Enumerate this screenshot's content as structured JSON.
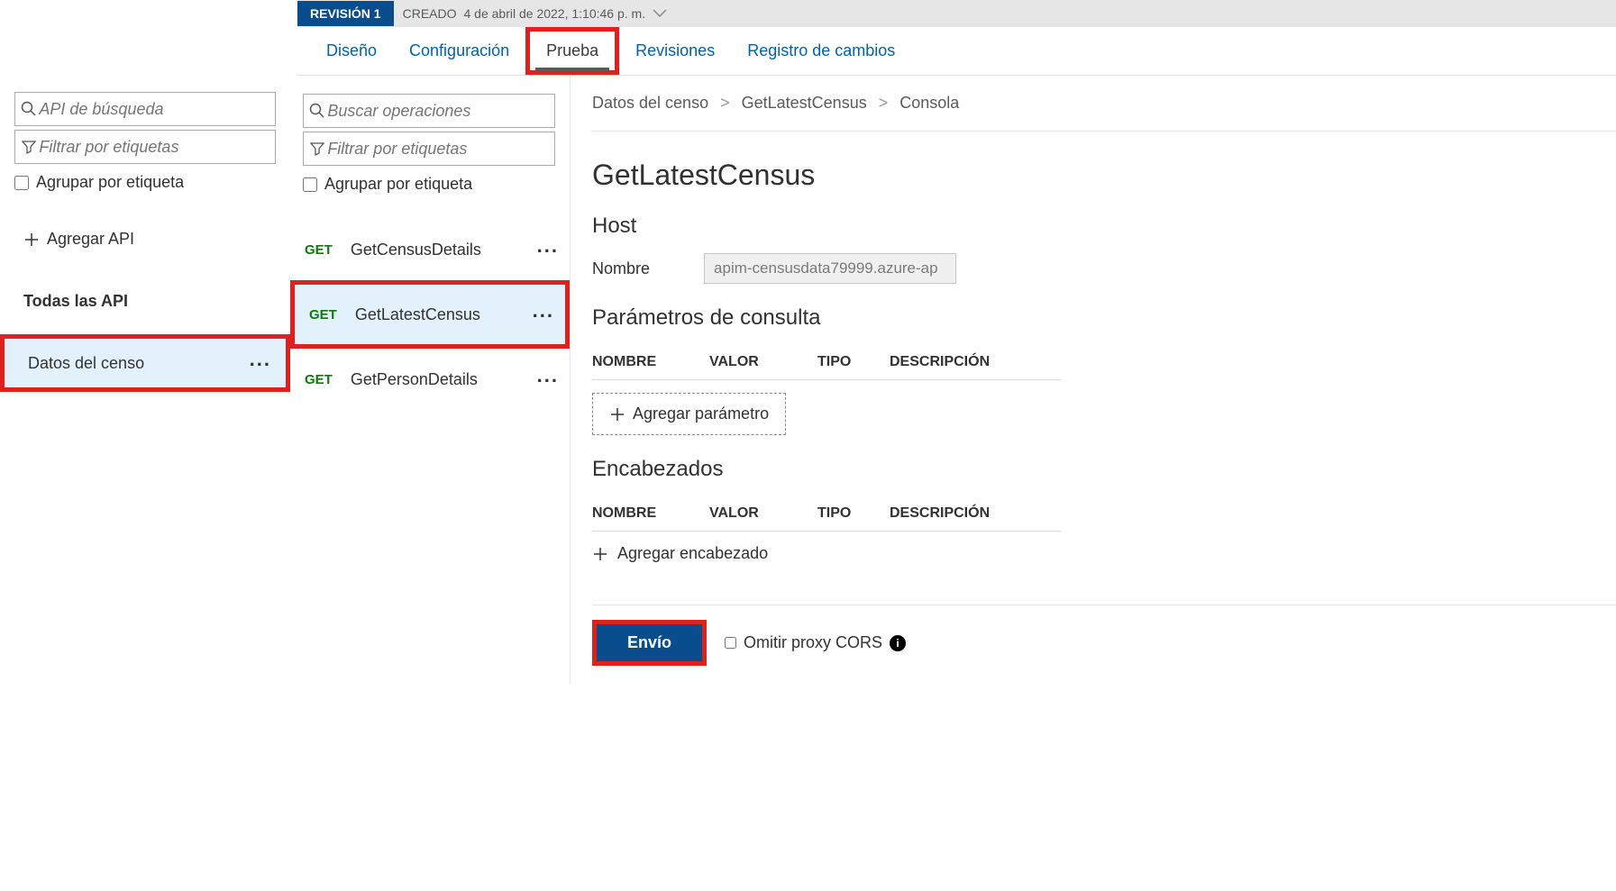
{
  "revision": {
    "label": "REVISIÓN 1",
    "created_prefix": "CREADO",
    "created_date": "4 de abril de 2022, 1:10:46 p. m."
  },
  "tabs": {
    "design": "Diseño",
    "settings": "Configuración",
    "test": "Prueba",
    "revisions": "Revisiones",
    "changelog": "Registro de cambios"
  },
  "sidebar_apis": {
    "search_placeholder": "API de búsqueda",
    "filter_placeholder": "Filtrar por etiquetas",
    "group_by_tag": "Agrupar por etiqueta",
    "add_api": "Agregar API",
    "all_apis": "Todas las API",
    "selected_api": "Datos del censo"
  },
  "sidebar_ops": {
    "search_placeholder": "Buscar operaciones",
    "filter_placeholder": "Filtrar por etiquetas",
    "group_by_tag": "Agrupar por etiqueta",
    "items": [
      {
        "method": "GET",
        "name": "GetCensusDetails"
      },
      {
        "method": "GET",
        "name": "GetLatestCensus"
      },
      {
        "method": "GET",
        "name": "GetPersonDetails"
      }
    ]
  },
  "breadcrumb": {
    "api": "Datos del censo",
    "op": "GetLatestCensus",
    "console": "Consola"
  },
  "main": {
    "title": "GetLatestCensus",
    "host_heading": "Host",
    "host_name_label": "Nombre",
    "host_value": "apim-censusdata79999.azure-ap",
    "query_params_heading": "Parámetros de consulta",
    "col_name": "NOMBRE",
    "col_value": "VALOR",
    "col_type": "TIPO",
    "col_desc": "DESCRIPCIÓN",
    "add_param": "Agregar parámetro",
    "headers_heading": "Encabezados",
    "add_header": "Agregar encabezado",
    "send": "Envío",
    "skip_cors": "Omitir proxy CORS"
  }
}
